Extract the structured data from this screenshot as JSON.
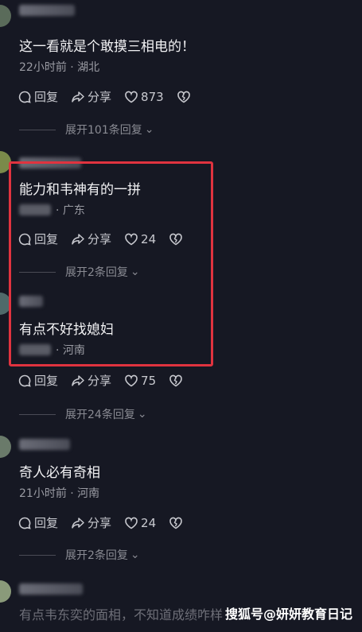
{
  "comments": [
    {
      "text": "这一看就是个敢摸三相电的！",
      "meta": "22小时前 · 湖北",
      "reply_label": "回复",
      "share_label": "分享",
      "likes": "873",
      "expand_label": "展开101条回复"
    },
    {
      "text": "能力和韦神有的一拼",
      "meta": "· 广东",
      "reply_label": "回复",
      "share_label": "分享",
      "likes": "24",
      "expand_label": "展开2条回复"
    },
    {
      "text": "有点不好找媳妇",
      "meta": "· 河南",
      "reply_label": "回复",
      "share_label": "分享",
      "likes": "75",
      "expand_label": "展开24条回复"
    },
    {
      "text": "奇人必有奇相",
      "meta": "21小时前 · 河南",
      "reply_label": "回复",
      "share_label": "分享",
      "likes": "24",
      "expand_label": "展开2条回复"
    }
  ],
  "last_comment_preview": "有点韦东奕的面相，不知道成绩咋样",
  "watermark": "搜狐号@妍妍教育日记",
  "colors": {
    "highlight_box": "#e0333f",
    "background": "#161823"
  }
}
